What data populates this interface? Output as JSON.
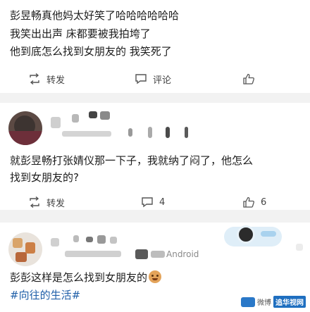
{
  "post1": {
    "lines": [
      "彭昱畅真他妈太好笑了哈哈哈哈哈哈",
      "我笑出出声 床都要被我拍垮了",
      "他到底怎么找到女朋友的 我笑死了"
    ],
    "repost_label": "转发",
    "comment_label": "评论"
  },
  "post2": {
    "lines": [
      "就彭昱畅打张婧仪那一下子，我就纳了闷了，他怎么",
      "找到女朋友的?"
    ],
    "repost_label": "转发",
    "comment_count": "4",
    "like_count": "6"
  },
  "post3": {
    "meta_suffix": "Android",
    "text": "彭彭这样是怎么找到女朋友的",
    "topic": "#向往的生活#"
  },
  "watermark": {
    "text": "微博",
    "badge": "追华视网"
  }
}
